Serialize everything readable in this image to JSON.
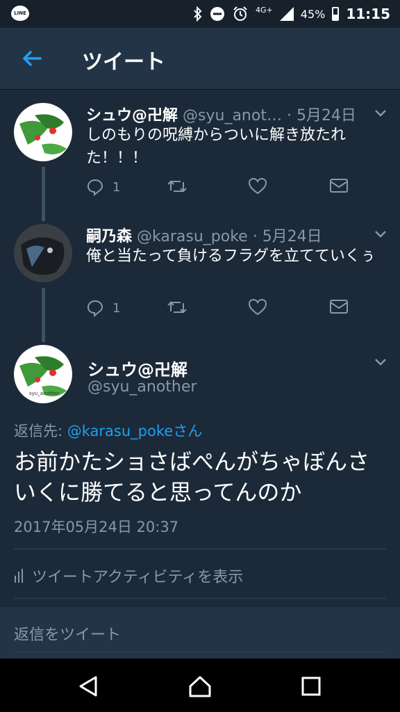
{
  "status_bar": {
    "notification_icon": "line-app-icon",
    "line_label": "LINE",
    "network": "4G+",
    "battery": "45%",
    "battery_level": 0.45,
    "time": "11:15"
  },
  "app_bar": {
    "title": "ツイート"
  },
  "thread": [
    {
      "name": "シュウ@卍解",
      "handle": "@syu_anot…",
      "date": "· 5月24日",
      "text": "しのもりの呪縛からついに解き放たれた！！！",
      "reply_count": "1"
    },
    {
      "name": "嗣乃森",
      "handle": "@karasu_poke",
      "date": "· 5月24日",
      "text": "俺と当たって負けるフラグを立てていくぅ",
      "reply_count": "1"
    }
  ],
  "main_tweet": {
    "name": "シュウ@卍解",
    "handle": "@syu_another",
    "avatar_label": "syu_another",
    "reply_to_prefix": "返信先: ",
    "reply_to_user": "@karasu_pokeさん",
    "text": "お前かたショさばぺんがちゃぼんさいくに勝てると思ってんのか",
    "timestamp": "2017年05月24日 20:37",
    "activity_label": "ツイートアクティビティを表示"
  },
  "reply_bar": {
    "placeholder": "返信をツイート"
  },
  "colors": {
    "background": "#1c2938",
    "app_bar": "#243447",
    "accent": "#1da1f2",
    "secondary_text": "#8899a6"
  }
}
